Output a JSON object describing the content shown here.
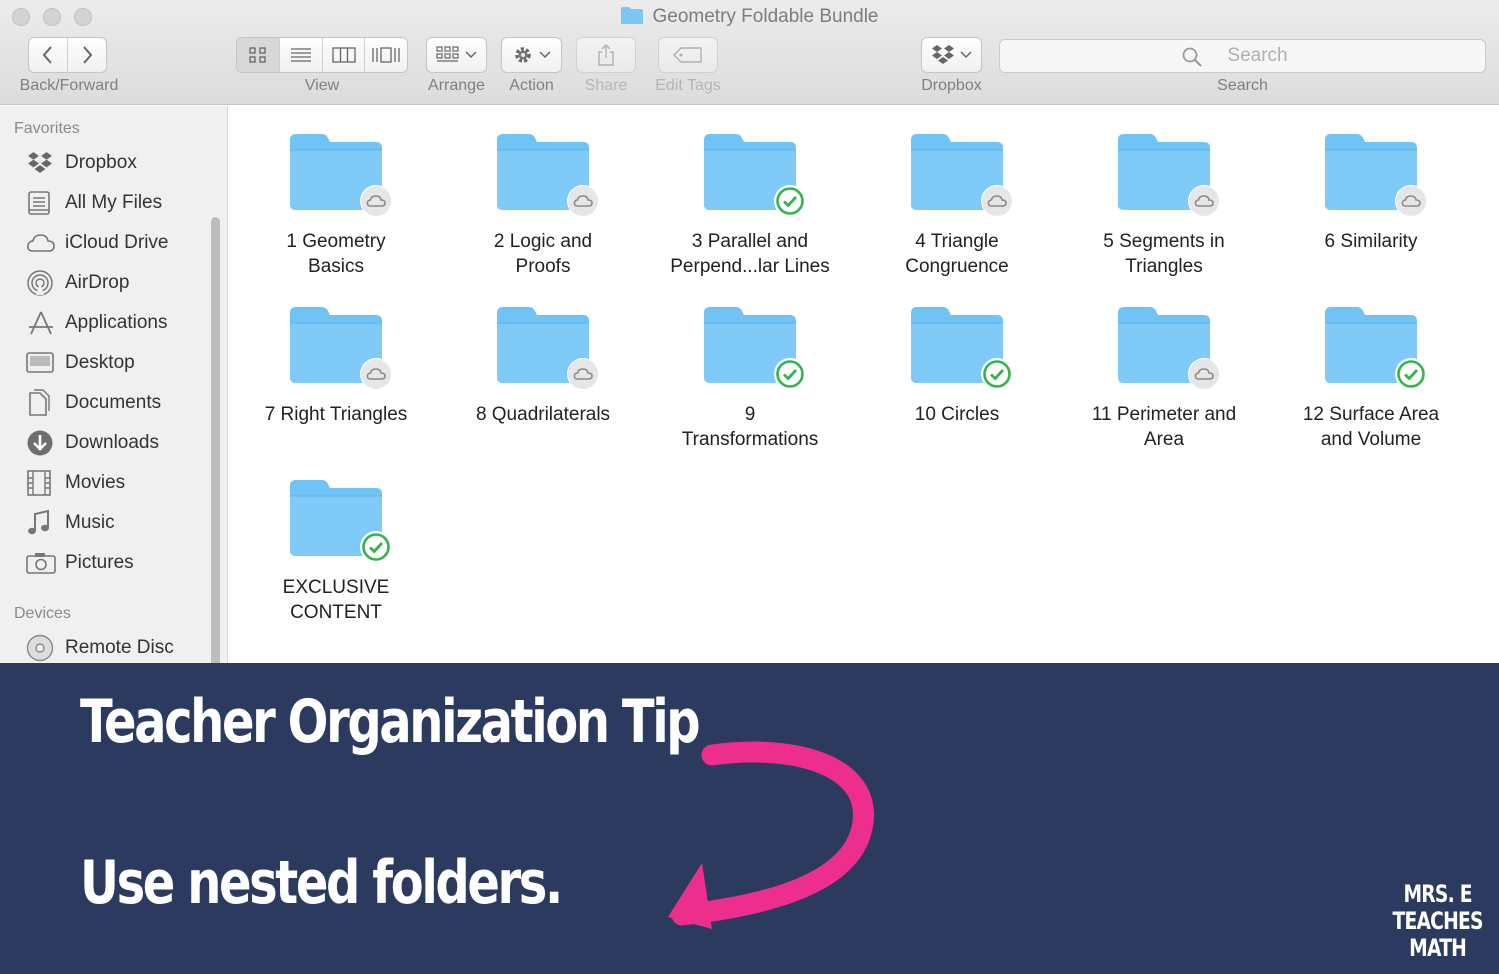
{
  "window": {
    "title": "Geometry Foldable Bundle"
  },
  "toolbar": {
    "back_forward_label": "Back/Forward",
    "view_label": "View",
    "arrange_label": "Arrange",
    "action_label": "Action",
    "share_label": "Share",
    "edit_tags_label": "Edit Tags",
    "dropbox_label": "Dropbox",
    "search_label": "Search",
    "search_placeholder": "Search"
  },
  "sidebar": {
    "favorites_heading": "Favorites",
    "favorites": [
      {
        "label": "Dropbox",
        "icon": "dropbox-icon"
      },
      {
        "label": "All My Files",
        "icon": "all-files-icon"
      },
      {
        "label": "iCloud Drive",
        "icon": "cloud-icon"
      },
      {
        "label": "AirDrop",
        "icon": "airdrop-icon"
      },
      {
        "label": "Applications",
        "icon": "applications-icon"
      },
      {
        "label": "Desktop",
        "icon": "desktop-icon"
      },
      {
        "label": "Documents",
        "icon": "documents-icon"
      },
      {
        "label": "Downloads",
        "icon": "downloads-icon"
      },
      {
        "label": "Movies",
        "icon": "movies-icon"
      },
      {
        "label": "Music",
        "icon": "music-icon"
      },
      {
        "label": "Pictures",
        "icon": "pictures-icon"
      }
    ],
    "devices_heading": "Devices",
    "devices": [
      {
        "label": "Remote Disc",
        "icon": "disc-icon"
      }
    ]
  },
  "folders": [
    {
      "label": "1 Geometry\nBasics",
      "status": "cloud"
    },
    {
      "label": "2 Logic and\nProofs",
      "status": "cloud"
    },
    {
      "label": "3 Parallel and\nPerpend...lar Lines",
      "status": "synced"
    },
    {
      "label": "4 Triangle\nCongruence",
      "status": "cloud"
    },
    {
      "label": "5 Segments in\nTriangles",
      "status": "cloud"
    },
    {
      "label": "6 Similarity",
      "status": "cloud"
    },
    {
      "label": "7 Right Triangles",
      "status": "cloud"
    },
    {
      "label": "8 Quadrilaterals",
      "status": "cloud"
    },
    {
      "label": "9\nTransformations",
      "status": "synced"
    },
    {
      "label": "10 Circles",
      "status": "synced"
    },
    {
      "label": "11 Perimeter and\nArea",
      "status": "cloud"
    },
    {
      "label": "12 Surface Area\nand Volume",
      "status": "synced"
    },
    {
      "label": "EXCLUSIVE\nCONTENT",
      "status": "synced"
    }
  ],
  "banner": {
    "title": "Teacher Organization Tip",
    "body": "Use nested folders.",
    "brand_lines": [
      "MRS. E",
      "TEACHES",
      "MATH"
    ]
  },
  "colors": {
    "folder_blue": "#6fc3f5",
    "synced_green": "#35b44a",
    "banner_navy": "#2b3a5e",
    "arrow_pink": "#ee2e8c"
  }
}
